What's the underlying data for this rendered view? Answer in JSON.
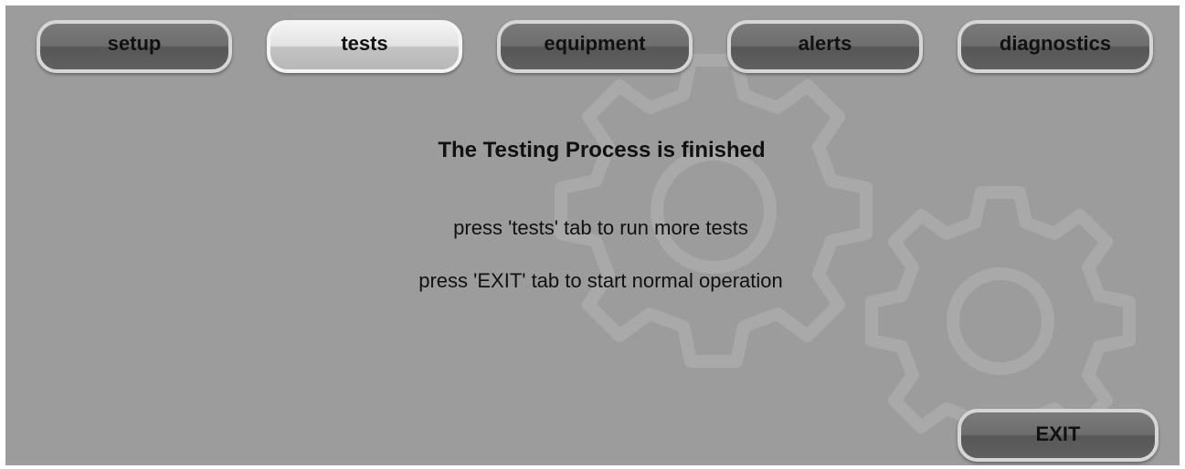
{
  "tabs": [
    {
      "label": "setup",
      "active": false
    },
    {
      "label": "tests",
      "active": true
    },
    {
      "label": "equipment",
      "active": false
    },
    {
      "label": "alerts",
      "active": false
    },
    {
      "label": "diagnostics",
      "active": false
    }
  ],
  "message": {
    "headline": "The Testing Process is finished",
    "line1": "press 'tests' tab to run more tests",
    "line2": "press 'EXIT' tab to start normal operation"
  },
  "exit_label": "EXIT",
  "background_decoration": "gear-icon",
  "colors": {
    "background": "#9c9c9c",
    "tab_inactive": "#6e6e6e",
    "tab_active": "#e4e4e4",
    "text": "#111111"
  }
}
